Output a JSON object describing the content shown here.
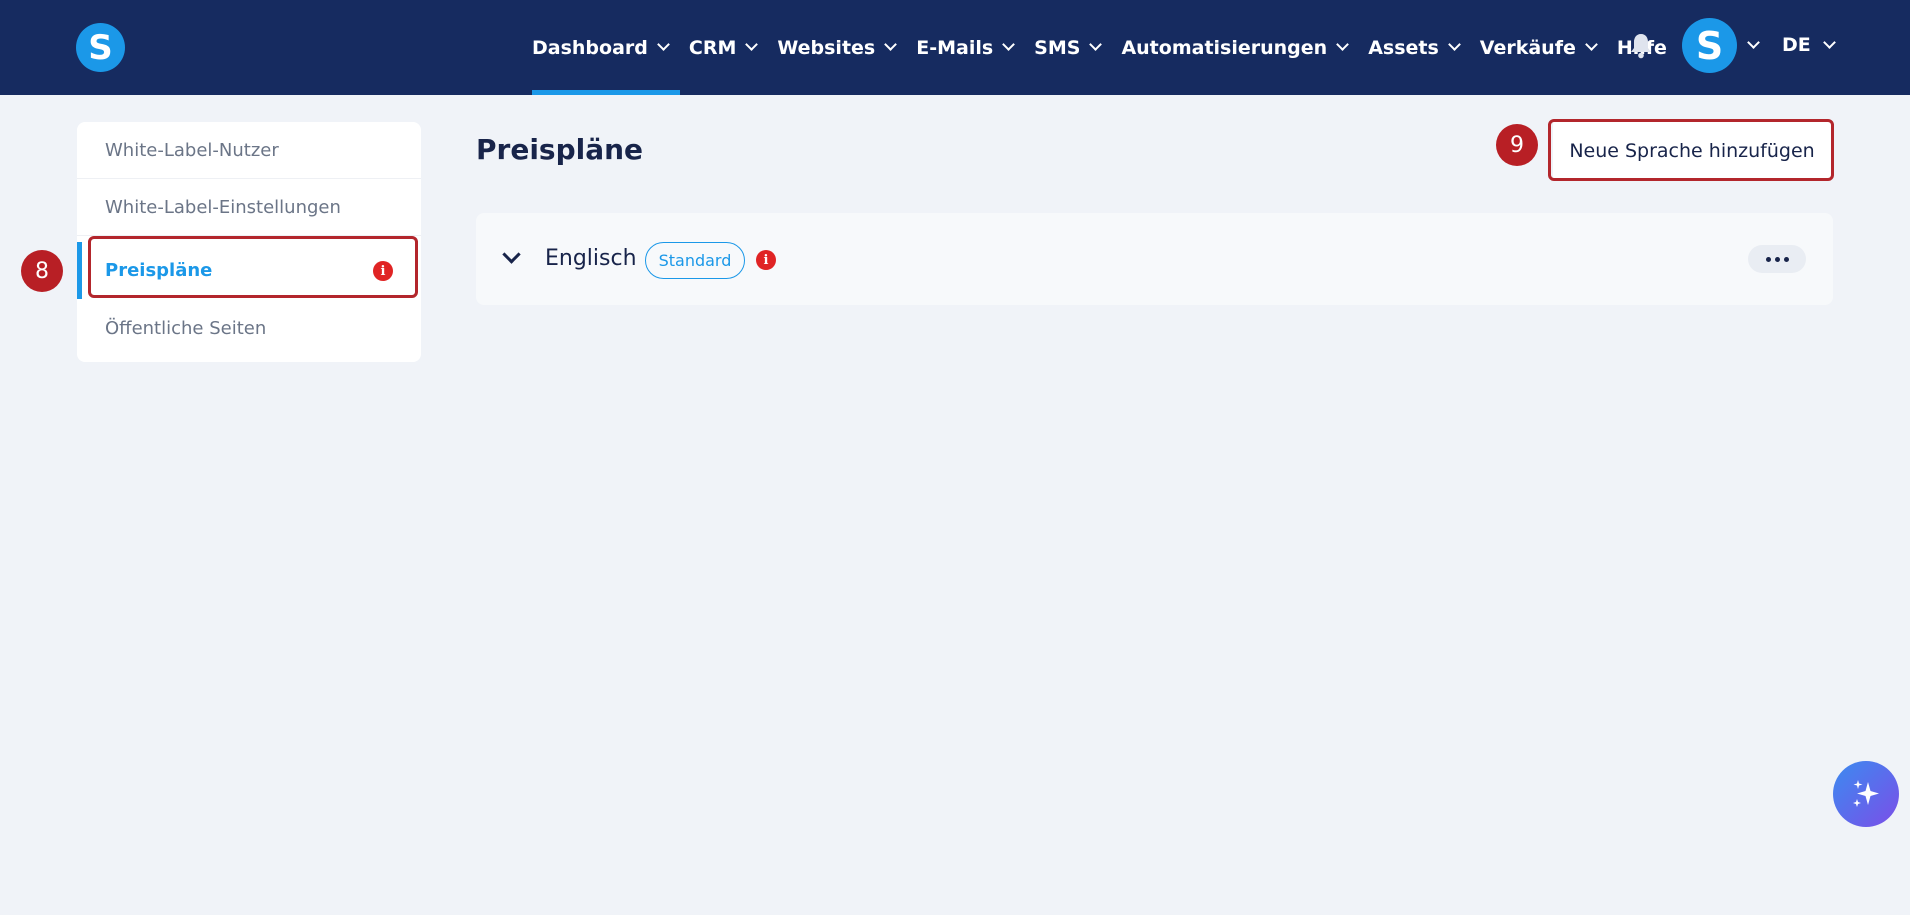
{
  "brand": {
    "logo_letter": "S",
    "accent": "#1b98e8",
    "nav_bg": "#162b60"
  },
  "nav": {
    "items": [
      {
        "label": "Dashboard",
        "active": true,
        "has_dropdown": true
      },
      {
        "label": "CRM",
        "has_dropdown": true
      },
      {
        "label": "Websites",
        "has_dropdown": true
      },
      {
        "label": "E-Mails",
        "has_dropdown": true
      },
      {
        "label": "SMS",
        "has_dropdown": true
      },
      {
        "label": "Automatisierungen",
        "has_dropdown": true
      },
      {
        "label": "Assets",
        "has_dropdown": true
      },
      {
        "label": "Verkäufe",
        "has_dropdown": true
      },
      {
        "label": "Hilfe",
        "has_dropdown": false
      }
    ],
    "bell_icon": "bell-icon",
    "avatar_letter": "S",
    "language": "DE"
  },
  "sidebar": {
    "items": [
      {
        "label": "White-Label-Nutzer"
      },
      {
        "label": "White-Label-Einstellungen"
      },
      {
        "label": "Preispläne",
        "active": true,
        "has_info": true
      },
      {
        "label": "Öffentliche Seiten"
      }
    ]
  },
  "annotations": {
    "step_sidebar": "8",
    "step_button": "9",
    "highlight_color": "#b3262c"
  },
  "main": {
    "title": "Preispläne",
    "add_language_button": "Neue Sprache hinzufügen",
    "languages": [
      {
        "name": "Englisch",
        "badge": "Standard",
        "has_info": true,
        "expanded": false
      }
    ]
  }
}
